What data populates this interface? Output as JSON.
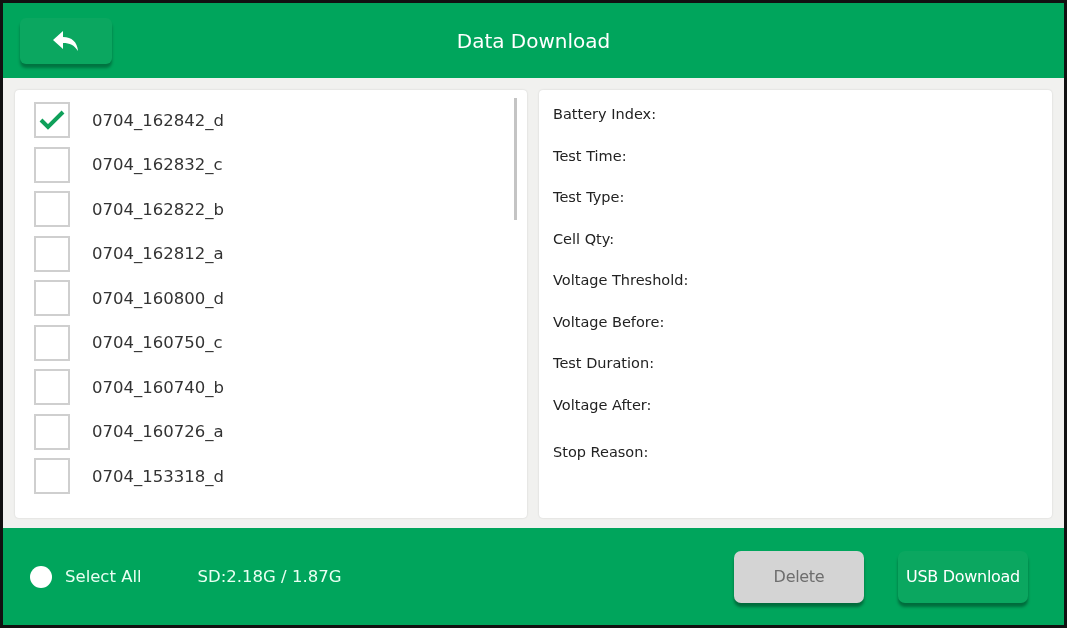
{
  "header": {
    "title": "Data Download"
  },
  "files": [
    {
      "name": "0704_162842_d",
      "checked": true
    },
    {
      "name": "0704_162832_c",
      "checked": false
    },
    {
      "name": "0704_162822_b",
      "checked": false
    },
    {
      "name": "0704_162812_a",
      "checked": false
    },
    {
      "name": "0704_160800_d",
      "checked": false
    },
    {
      "name": "0704_160750_c",
      "checked": false
    },
    {
      "name": "0704_160740_b",
      "checked": false
    },
    {
      "name": "0704_160726_a",
      "checked": false
    },
    {
      "name": "0704_153318_d",
      "checked": false
    }
  ],
  "details": [
    "Battery Index:",
    "Test Time:",
    "Test Type:",
    "Cell Qty:",
    "Voltage Threshold:",
    "Voltage Before:",
    "Test Duration:",
    "Voltage After:",
    "Stop Reason:"
  ],
  "footer": {
    "select_all": {
      "label": "Select All",
      "selected": false
    },
    "storage": "SD:2.18G / 1.87G",
    "buttons": [
      {
        "label": "Delete",
        "disabled": true
      },
      {
        "label": "USB Download",
        "disabled": false
      }
    ]
  }
}
